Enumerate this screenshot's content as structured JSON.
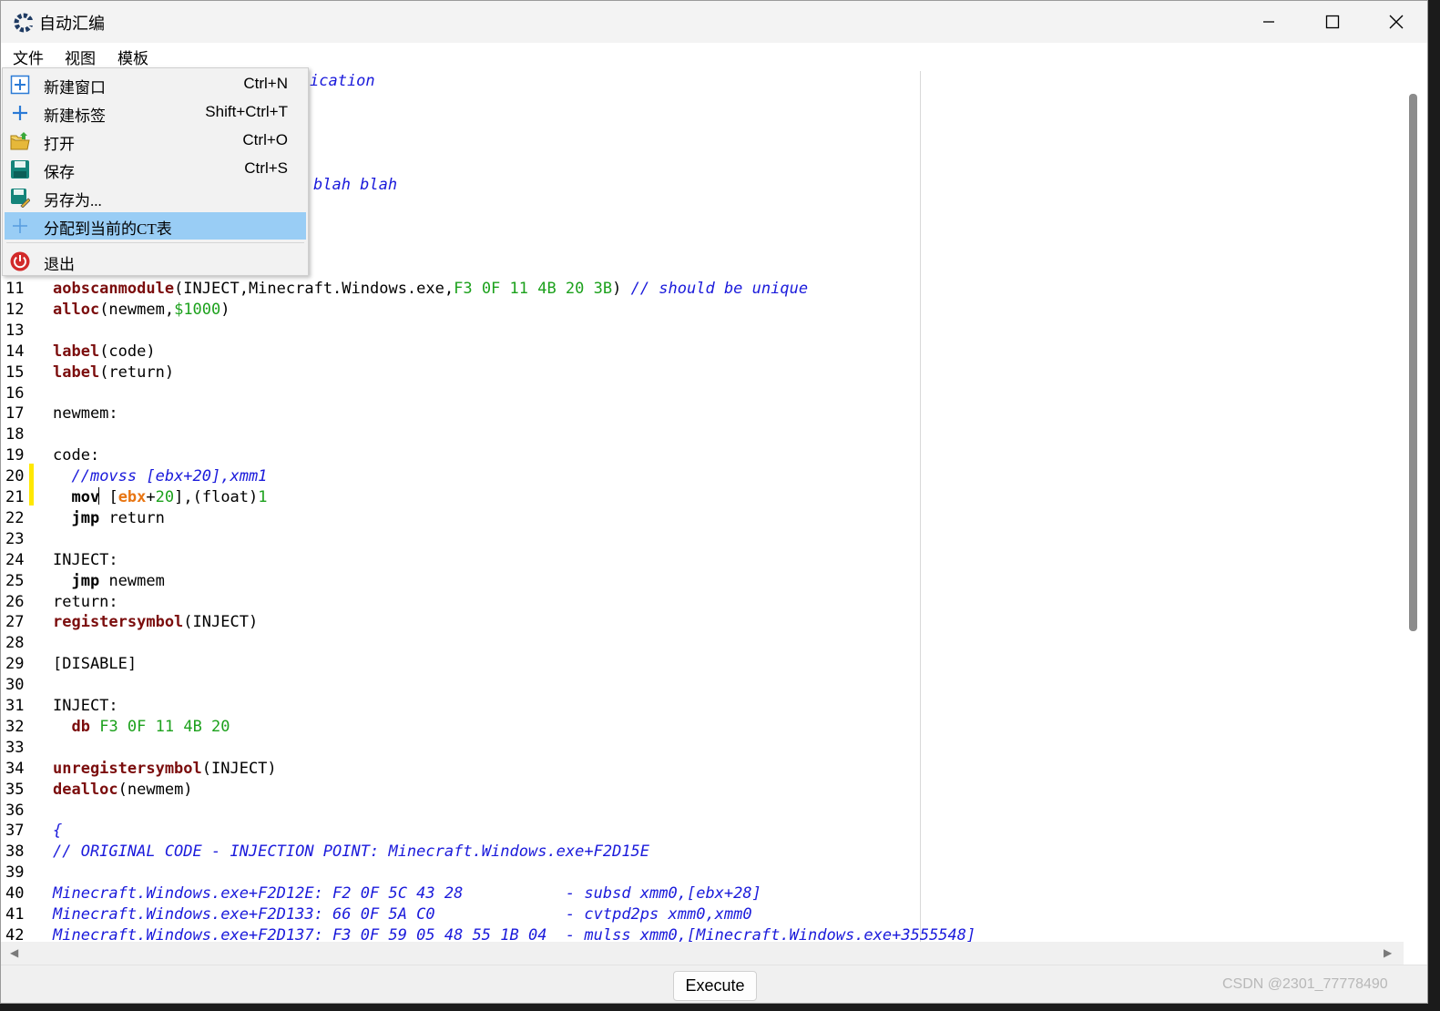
{
  "window": {
    "title": "自动汇编"
  },
  "menubar": {
    "items": [
      "文件",
      "视图",
      "模板"
    ]
  },
  "file_menu": {
    "items": [
      {
        "label": "新建窗口",
        "shortcut": "Ctrl+N",
        "icon": "new-window-icon"
      },
      {
        "label": "新建标签",
        "shortcut": "Shift+Ctrl+T",
        "icon": "new-tab-icon"
      },
      {
        "label": "打开",
        "shortcut": "Ctrl+O",
        "icon": "open-folder-icon"
      },
      {
        "label": "保存",
        "shortcut": "Ctrl+S",
        "icon": "save-icon"
      },
      {
        "label": "另存为...",
        "shortcut": "",
        "icon": "save-as-icon"
      },
      {
        "label": "分配到当前的CT表",
        "shortcut": "",
        "icon": "assign-plus-icon",
        "selected": true
      },
      {
        "label": "退出",
        "shortcut": "",
        "icon": "exit-power-icon"
      }
    ]
  },
  "editor": {
    "partial_line_1": "ication",
    "partial_line_6": "blah blah",
    "lines": [
      {
        "n": "11",
        "tokens": [
          [
            "kw",
            "aobscanmodule"
          ],
          [
            "t",
            "(INJECT,Minecraft.Windows.exe,"
          ],
          [
            "num",
            "F3 0F 11 4B 20 3B"
          ],
          [
            "t",
            ") "
          ],
          [
            "cm",
            "// should be unique"
          ]
        ]
      },
      {
        "n": "12",
        "tokens": [
          [
            "kw",
            "alloc"
          ],
          [
            "t",
            "(newmem,"
          ],
          [
            "num",
            "$1000"
          ],
          [
            "t",
            ")"
          ]
        ]
      },
      {
        "n": "13",
        "tokens": []
      },
      {
        "n": "14",
        "tokens": [
          [
            "kw",
            "label"
          ],
          [
            "t",
            "(code)"
          ]
        ]
      },
      {
        "n": "15",
        "tokens": [
          [
            "kw",
            "label"
          ],
          [
            "t",
            "(return)"
          ]
        ]
      },
      {
        "n": "16",
        "tokens": []
      },
      {
        "n": "17",
        "tokens": [
          [
            "t",
            "newmem:"
          ]
        ]
      },
      {
        "n": "18",
        "tokens": []
      },
      {
        "n": "19",
        "tokens": [
          [
            "t",
            "code:"
          ]
        ]
      },
      {
        "n": "20",
        "tokens": [
          [
            "t",
            "  "
          ],
          [
            "cm",
            "//movss [ebx+20],xmm1"
          ]
        ]
      },
      {
        "n": "21",
        "tokens": [
          [
            "t",
            "  "
          ],
          [
            "in",
            "mov"
          ],
          [
            "caret",
            ""
          ],
          [
            "t",
            " ["
          ],
          [
            "reg",
            "ebx"
          ],
          [
            "t",
            "+"
          ],
          [
            "num",
            "20"
          ],
          [
            "t",
            "],(float)"
          ],
          [
            "num",
            "1"
          ]
        ]
      },
      {
        "n": "22",
        "tokens": [
          [
            "t",
            "  "
          ],
          [
            "in",
            "jmp"
          ],
          [
            "t",
            " return"
          ]
        ]
      },
      {
        "n": "23",
        "tokens": []
      },
      {
        "n": "24",
        "tokens": [
          [
            "t",
            "INJECT:"
          ]
        ]
      },
      {
        "n": "25",
        "tokens": [
          [
            "t",
            "  "
          ],
          [
            "in",
            "jmp"
          ],
          [
            "t",
            " newmem"
          ]
        ]
      },
      {
        "n": "26",
        "tokens": [
          [
            "t",
            "return:"
          ]
        ]
      },
      {
        "n": "27",
        "tokens": [
          [
            "kw",
            "registersymbol"
          ],
          [
            "t",
            "(INJECT)"
          ]
        ]
      },
      {
        "n": "28",
        "tokens": []
      },
      {
        "n": "29",
        "tokens": [
          [
            "t",
            "[DISABLE]"
          ]
        ]
      },
      {
        "n": "30",
        "tokens": []
      },
      {
        "n": "31",
        "tokens": [
          [
            "t",
            "INJECT:"
          ]
        ]
      },
      {
        "n": "32",
        "tokens": [
          [
            "t",
            "  "
          ],
          [
            "kw",
            "db"
          ],
          [
            "t",
            " "
          ],
          [
            "num",
            "F3 0F 11 4B 20"
          ]
        ]
      },
      {
        "n": "33",
        "tokens": []
      },
      {
        "n": "34",
        "tokens": [
          [
            "kw",
            "unregistersymbol"
          ],
          [
            "t",
            "(INJECT)"
          ]
        ]
      },
      {
        "n": "35",
        "tokens": [
          [
            "kw",
            "dealloc"
          ],
          [
            "t",
            "(newmem)"
          ]
        ]
      },
      {
        "n": "36",
        "tokens": []
      },
      {
        "n": "37",
        "tokens": [
          [
            "cm",
            "{"
          ]
        ]
      },
      {
        "n": "38",
        "tokens": [
          [
            "cm",
            "// ORIGINAL CODE - INJECTION POINT: Minecraft.Windows.exe+F2D15E"
          ]
        ]
      },
      {
        "n": "39",
        "tokens": []
      },
      {
        "n": "40",
        "tokens": [
          [
            "cm",
            "Minecraft.Windows.exe+F2D12E: F2 0F 5C 43 28           - subsd xmm0,[ebx+28]"
          ]
        ]
      },
      {
        "n": "41",
        "tokens": [
          [
            "cm",
            "Minecraft.Windows.exe+F2D133: 66 0F 5A C0              - cvtpd2ps xmm0,xmm0"
          ]
        ]
      },
      {
        "n": "42",
        "tokens": [
          [
            "cm",
            "Minecraft.Windows.exe+F2D137: F3 0F 59 05 48 55 1B 04  - mulss xmm0,[Minecraft.Windows.exe+3555548]"
          ]
        ]
      }
    ]
  },
  "bottom": {
    "execute_label": "Execute",
    "watermark": "CSDN @2301_77778490"
  },
  "colors": {
    "keyword": "#7b0d0d",
    "number": "#1ca11c",
    "comment": "#1a1adb",
    "register": "#e87512",
    "selection": "#99cdf5",
    "modified_marker": "#ffe800"
  }
}
